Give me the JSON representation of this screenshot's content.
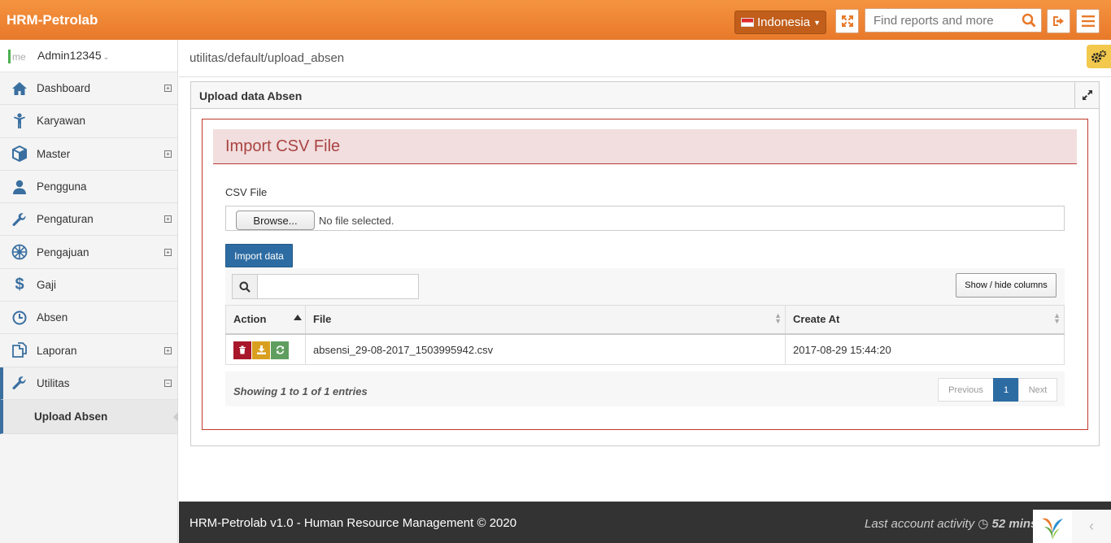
{
  "app": {
    "title": "HRM-Petrolab"
  },
  "header": {
    "language": "Indonesia",
    "search_placeholder": "Find reports and more"
  },
  "user": {
    "prefix": "me",
    "name": "Admin12345"
  },
  "sidebar": {
    "items": [
      {
        "label": "Dashboard",
        "icon": "home-icon",
        "expand": "+"
      },
      {
        "label": "Karyawan",
        "icon": "person-icon"
      },
      {
        "label": "Master",
        "icon": "cube-icon",
        "expand": "+"
      },
      {
        "label": "Pengguna",
        "icon": "user-icon"
      },
      {
        "label": "Pengaturan",
        "icon": "wrench-icon",
        "expand": "+"
      },
      {
        "label": "Pengajuan",
        "icon": "gear-icon",
        "expand": "+"
      },
      {
        "label": "Gaji",
        "icon": "dollar-icon"
      },
      {
        "label": "Absen",
        "icon": "clock-icon"
      },
      {
        "label": "Laporan",
        "icon": "copy-icon",
        "expand": "+"
      },
      {
        "label": "Utilitas",
        "icon": "wrench-icon",
        "expand": "−"
      }
    ],
    "sub_item": "Upload Absen"
  },
  "breadcrumb": "utilitas/default/upload_absen",
  "widget": {
    "title": "Upload data Absen"
  },
  "panel": {
    "title": "Import CSV File",
    "csv_label": "CSV File",
    "browse_label": "Browse...",
    "file_status": "No file selected.",
    "import_label": "Import data"
  },
  "table": {
    "colvis_label": "Show / hide columns",
    "columns": [
      "Action",
      "File",
      "Create At"
    ],
    "rows": [
      {
        "file": "absensi_29-08-2017_1503995942.csv",
        "created_at": "2017-08-29 15:44:20"
      }
    ],
    "info": "Showing 1 to 1 of 1 entries",
    "pager": {
      "previous": "Previous",
      "page": "1",
      "next": "Next"
    }
  },
  "footer": {
    "left": "HRM-Petrolab v1.0 - Human Resource Management © 2020",
    "right_prefix": "Last account activity",
    "right_value": "52 mins"
  },
  "colors": {
    "header": "#e8792a",
    "primary": "#2d6ca2",
    "danger_border": "#c0392b",
    "panel_bg": "#f2dede"
  }
}
